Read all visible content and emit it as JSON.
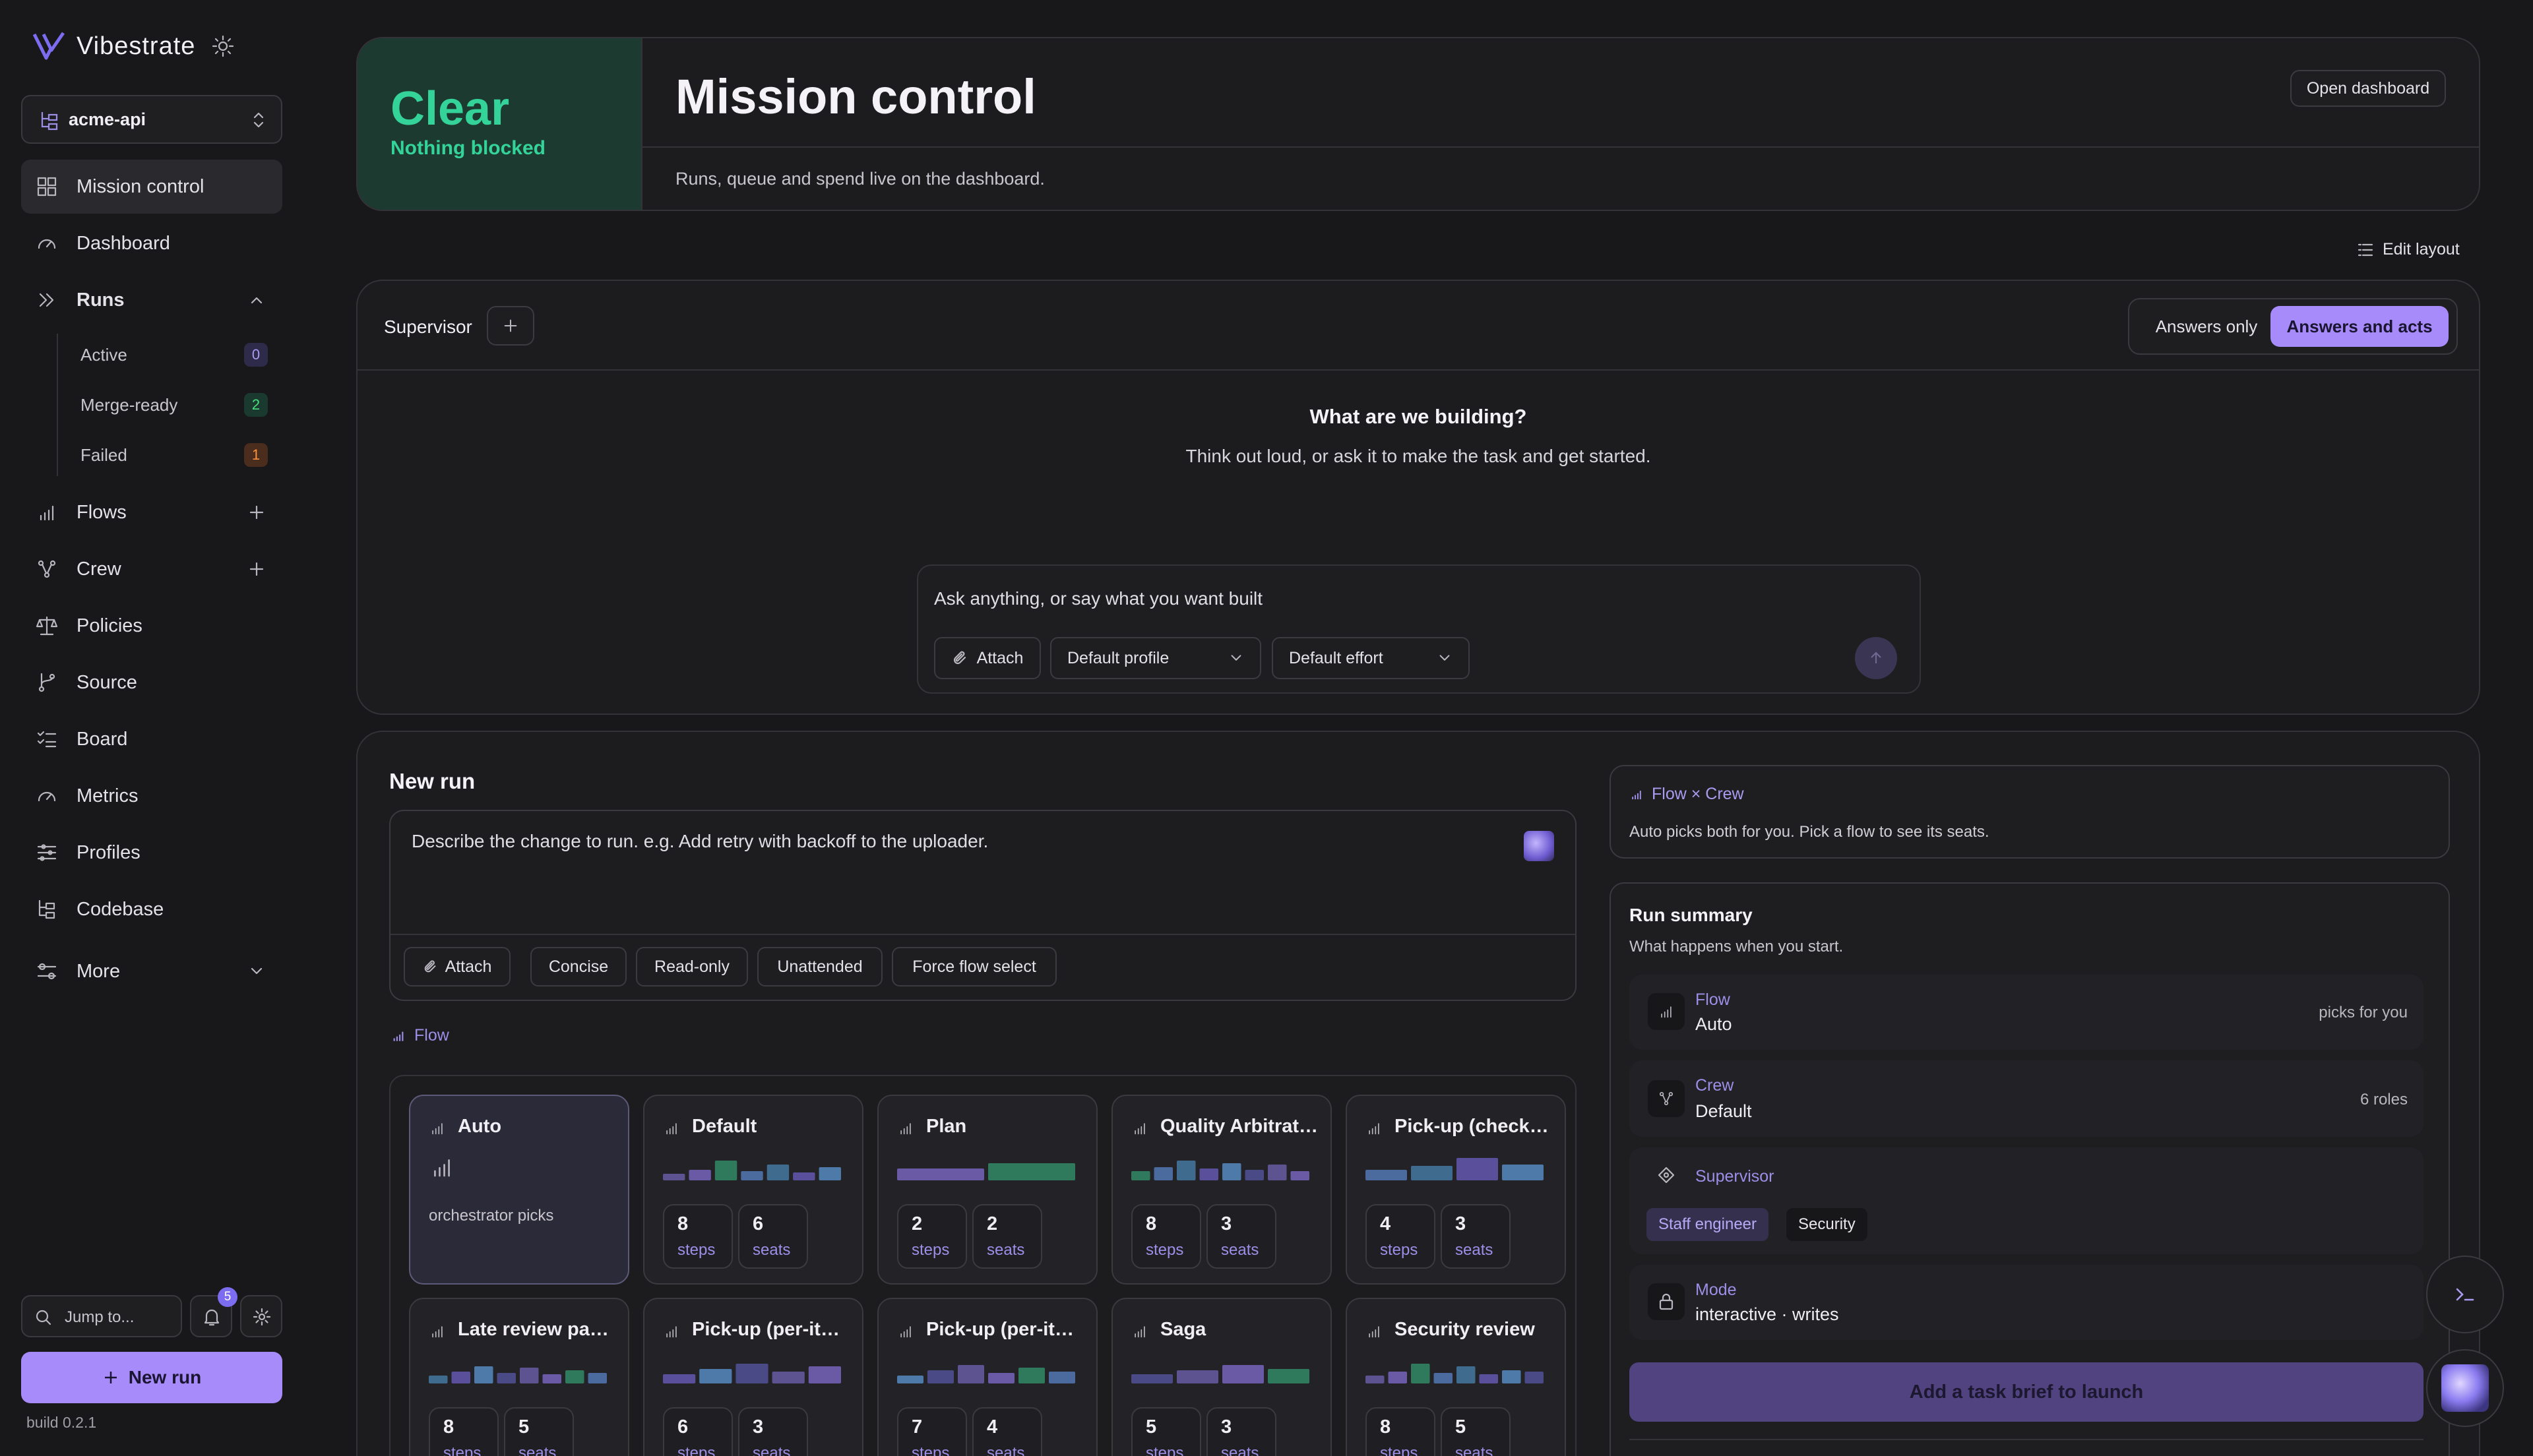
{
  "app": {
    "name": "Vibestrate",
    "build": "build 0.2.1"
  },
  "colors": {
    "accent": "#a78bfa",
    "clear_green": "#34d399",
    "bg": "#18181a"
  },
  "sidebar": {
    "project": "acme-api",
    "nav": [
      {
        "label": "Mission control",
        "icon": "grid-icon"
      },
      {
        "label": "Dashboard",
        "icon": "gauge-icon"
      },
      {
        "label": "Runs",
        "icon": "chevrons-right-icon"
      },
      {
        "label": "Flows",
        "icon": "bars-icon"
      },
      {
        "label": "Crew",
        "icon": "nodes-icon"
      },
      {
        "label": "Policies",
        "icon": "scale-icon"
      },
      {
        "label": "Source",
        "icon": "git-branch-icon"
      },
      {
        "label": "Board",
        "icon": "checklist-icon"
      },
      {
        "label": "Metrics",
        "icon": "gauge-icon"
      },
      {
        "label": "Profiles",
        "icon": "sliders-icon"
      },
      {
        "label": "Codebase",
        "icon": "tree-icon"
      },
      {
        "label": "More",
        "icon": "toggles-icon"
      }
    ],
    "runs_sub": [
      {
        "label": "Active",
        "count": "0"
      },
      {
        "label": "Merge-ready",
        "count": "2"
      },
      {
        "label": "Failed",
        "count": "1"
      }
    ],
    "jump_placeholder": "Jump to...",
    "notifications": "5",
    "new_run": "New run"
  },
  "status": {
    "title": "Clear",
    "subtitle": "Nothing blocked"
  },
  "header": {
    "title": "Mission control",
    "subtitle": "Runs, queue and spend live on the dashboard.",
    "open_dashboard": "Open dashboard"
  },
  "edit_layout": "Edit layout",
  "supervisor": {
    "label": "Supervisor",
    "mode_options": [
      "Answers only",
      "Answers and acts"
    ],
    "selected_mode": "Answers and acts",
    "heading": "What are we building?",
    "subheading": "Think out loud, or ask it to make the task and get started.",
    "input_placeholder": "Ask anything, or say what you want built",
    "attach": "Attach",
    "profile": "Default profile",
    "effort": "Default effort"
  },
  "new_run": {
    "title": "New run",
    "placeholder": "Describe the change to run. e.g. Add retry with backoff to the uploader.",
    "chips": [
      "Attach",
      "Concise",
      "Read-only",
      "Unattended",
      "Force flow select"
    ],
    "flow_label": "Flow",
    "flows": [
      {
        "name": "Auto",
        "note": "orchestrator picks",
        "selected": true
      },
      {
        "name": "Default",
        "steps": "8",
        "seats": "6"
      },
      {
        "name": "Plan",
        "steps": "2",
        "seats": "2"
      },
      {
        "name": "Quality Arbitration",
        "steps": "8",
        "seats": "3"
      },
      {
        "name": "Pick-up (checklist)",
        "steps": "4",
        "seats": "3"
      },
      {
        "name": "Late review panel",
        "steps": "8",
        "seats": "5"
      },
      {
        "name": "Pick-up (per-item)",
        "steps": "6",
        "seats": "3"
      },
      {
        "name": "Pick-up (per-item)",
        "steps": "7",
        "seats": "4"
      },
      {
        "name": "Saga",
        "steps": "5",
        "seats": "3"
      },
      {
        "name": "Security review",
        "steps": "8",
        "seats": "5"
      }
    ],
    "steps_unit": "steps",
    "seats_unit": "seats"
  },
  "flow_crew": {
    "title": "Flow × Crew",
    "desc": "Auto picks both for you. Pick a flow to see its seats."
  },
  "summary": {
    "title": "Run summary",
    "subtitle": "What happens when you start.",
    "flow": {
      "key": "Flow",
      "value": "Auto",
      "right": "picks for you"
    },
    "crew": {
      "key": "Crew",
      "value": "Default",
      "right": "6 roles"
    },
    "supervisor": {
      "key": "Supervisor",
      "tags": [
        "Staff engineer",
        "Security"
      ]
    },
    "mode": {
      "key": "Mode",
      "value": "interactive · writes"
    },
    "launch": "Add a task brief to launch"
  }
}
